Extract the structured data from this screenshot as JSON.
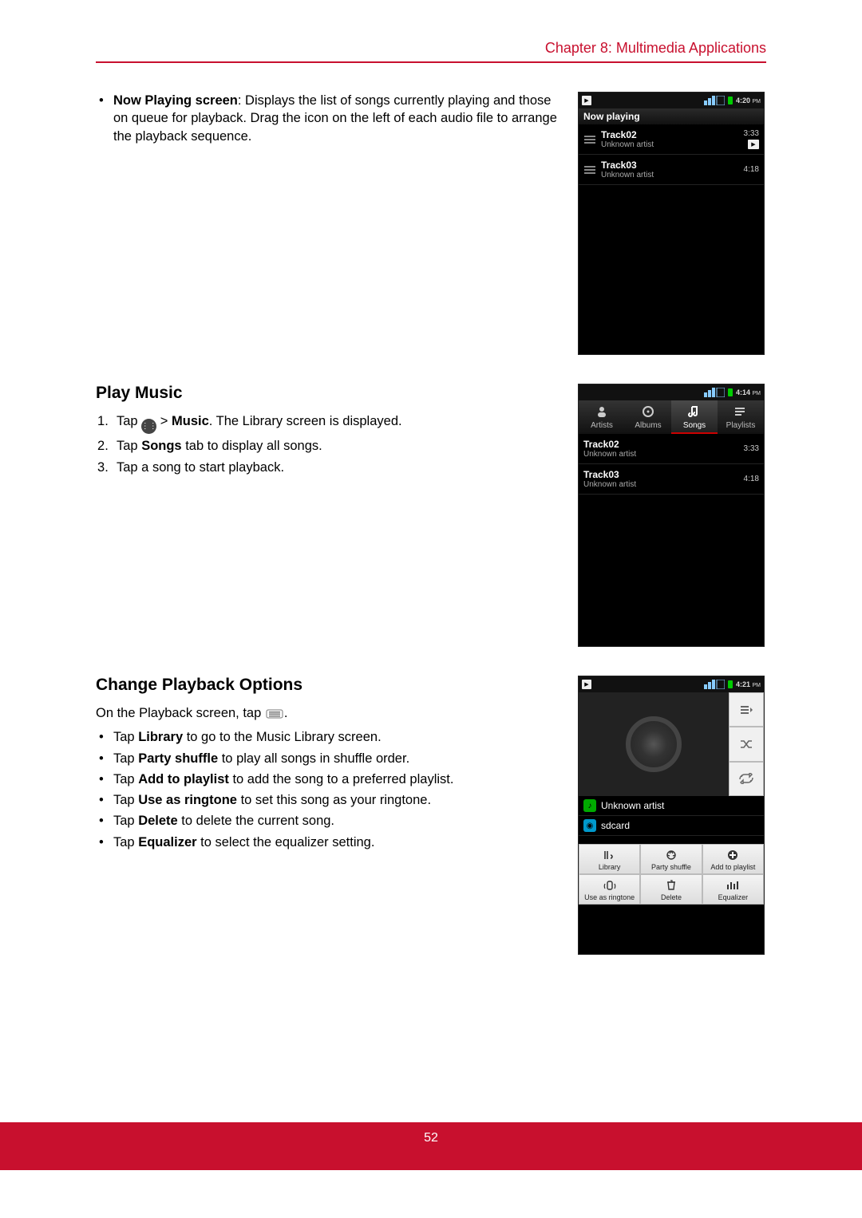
{
  "chapter_header": "Chapter 8: Multimedia Applications",
  "page_number": "52",
  "section1": {
    "bullet_label": "Now Playing screen",
    "bullet_text": ": Displays the list of songs currently playing and those on queue for playback. Drag the icon on the left of each audio file to arrange the playback sequence."
  },
  "section2": {
    "heading": "Play Music",
    "steps": [
      {
        "pre": "Tap ",
        "bold": "Music",
        "post": ". The Library screen is displayed.",
        "has_icon": true,
        "sep": " > "
      },
      {
        "pre": "Tap ",
        "bold": "Songs",
        "post": " tab to display all songs."
      },
      {
        "pre": "Tap a song to start playback.",
        "bold": "",
        "post": ""
      }
    ]
  },
  "section3": {
    "heading": "Change Playback Options",
    "intro_pre": "On the Playback screen, tap ",
    "intro_post": ".",
    "bullets": [
      {
        "pre": "Tap ",
        "bold": "Library",
        "post": " to go to the Music Library screen."
      },
      {
        "pre": "Tap ",
        "bold": "Party shuffle",
        "post": " to play all songs in shuffle order."
      },
      {
        "pre": "Tap ",
        "bold": "Add to playlist",
        "post": " to add the song to a preferred playlist."
      },
      {
        "pre": "Tap ",
        "bold": "Use as ringtone",
        "post": " to set this song as your ringtone."
      },
      {
        "pre": "Tap ",
        "bold": "Delete",
        "post": " to delete the current song."
      },
      {
        "pre": "Tap ",
        "bold": "Equalizer",
        "post": " to select the equalizer setting."
      }
    ]
  },
  "shot1": {
    "time": "4:20",
    "time_suffix": "PM",
    "titlebar": "Now playing",
    "tracks": [
      {
        "title": "Track02",
        "artist": "Unknown artist",
        "duration": "3:33",
        "playing": true
      },
      {
        "title": "Track03",
        "artist": "Unknown artist",
        "duration": "4:18",
        "playing": false
      }
    ]
  },
  "shot2": {
    "time": "4:14",
    "time_suffix": "PM",
    "tabs": [
      {
        "label": "Artists"
      },
      {
        "label": "Albums"
      },
      {
        "label": "Songs",
        "active": true
      },
      {
        "label": "Playlists"
      }
    ],
    "tracks": [
      {
        "title": "Track02",
        "artist": "Unknown artist",
        "duration": "3:33"
      },
      {
        "title": "Track03",
        "artist": "Unknown artist",
        "duration": "4:18"
      }
    ]
  },
  "shot3": {
    "time": "4:21",
    "time_suffix": "PM",
    "artist_line": "Unknown artist",
    "album_line": "sdcard",
    "menu": [
      {
        "label": "Library"
      },
      {
        "label": "Party shuffle"
      },
      {
        "label": "Add to playlist"
      },
      {
        "label": "Use as ringtone"
      },
      {
        "label": "Delete"
      },
      {
        "label": "Equalizer"
      }
    ]
  }
}
